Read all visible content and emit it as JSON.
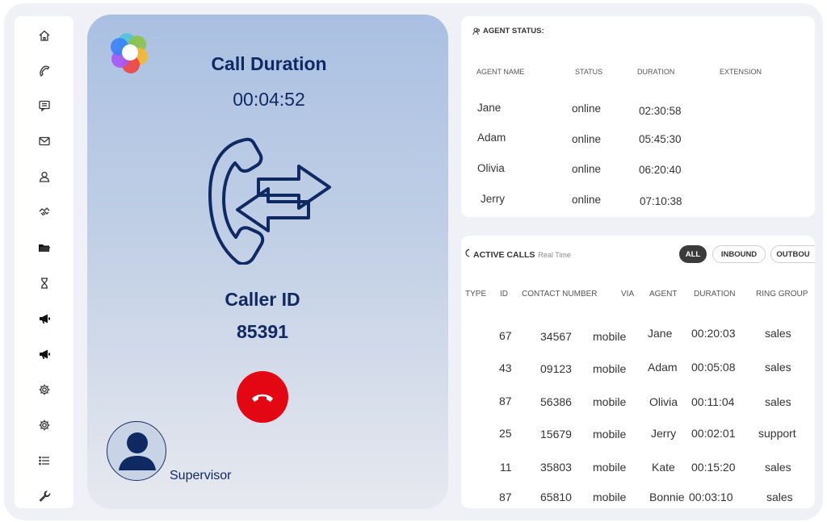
{
  "sidebar": {
    "items": [
      {
        "icon": "home-icon"
      },
      {
        "icon": "phone-icon"
      },
      {
        "icon": "chat-icon"
      },
      {
        "icon": "mail-icon"
      },
      {
        "icon": "user-icon"
      },
      {
        "icon": "handshake-icon"
      },
      {
        "icon": "folder-icon"
      },
      {
        "icon": "hourglass-icon"
      },
      {
        "icon": "megaphone-icon"
      },
      {
        "icon": "megaphone-icon"
      },
      {
        "icon": "gear-icon"
      },
      {
        "icon": "gear-icon"
      },
      {
        "icon": "list-icon"
      },
      {
        "icon": "wrench-icon"
      }
    ]
  },
  "call": {
    "duration_title": "Call Duration",
    "duration": "00:04:52",
    "caller_id_title": "Caller ID",
    "caller_id": "85391",
    "supervisor_label": "Supervisor"
  },
  "agent_status": {
    "title": "AGENT STATUS:",
    "headers": [
      "AGENT NAME",
      "STATUS",
      "DURATION",
      "EXTENSION"
    ],
    "rows": [
      {
        "name": "Jane",
        "status": "online",
        "duration": "02:30:58"
      },
      {
        "name": "Adam",
        "status": "online",
        "duration": "05:45:30"
      },
      {
        "name": "Olivia",
        "status": "online",
        "duration": "06:20:40"
      },
      {
        "name": "Jerry",
        "status": "online",
        "duration": "07:10:38"
      }
    ]
  },
  "active_calls": {
    "title": "ACTIVE CALLS",
    "subtitle": "Real Time",
    "filters": [
      "ALL",
      "INBOUND",
      "OUTBOU"
    ],
    "selected_filter": "ALL",
    "headers": [
      "TYPE",
      "ID",
      "CONTACT NUMBER",
      "VIA",
      "AGENT",
      "DURATION",
      "RING GROUP"
    ],
    "rows": [
      {
        "id": "67",
        "number": "34567",
        "via": "mobile",
        "agent": "Jane",
        "duration": "00:20:03",
        "group": "sales"
      },
      {
        "id": "43",
        "number": "09123",
        "via": "mobile",
        "agent": "Adam",
        "duration": "00:05:08",
        "group": "sales"
      },
      {
        "id": "87",
        "number": "56386",
        "via": "mobile",
        "agent": "Olivia",
        "duration": "00:11:04",
        "group": "sales"
      },
      {
        "id": "25",
        "number": "15679",
        "via": "mobile",
        "agent": "Jerry",
        "duration": "00:02:01",
        "group": "support"
      },
      {
        "id": "11",
        "number": "35803",
        "via": "mobile",
        "agent": "Kate",
        "duration": "00:15:20",
        "group": "sales"
      },
      {
        "id": "87",
        "number": "65810",
        "via": "mobile",
        "agent": "Bonnie",
        "duration": "00:03:10",
        "group": "sales"
      }
    ]
  },
  "colors": {
    "accent": "#0f2a63",
    "hangup": "#e30613",
    "card_gradient_top": "#aac0e2",
    "card_gradient_bottom": "#e7e9ef",
    "logo_petals": [
      "#4fc3d9",
      "#8bc34a",
      "#f5b82e",
      "#ef4444",
      "#a855f7",
      "#3b82f6"
    ]
  }
}
